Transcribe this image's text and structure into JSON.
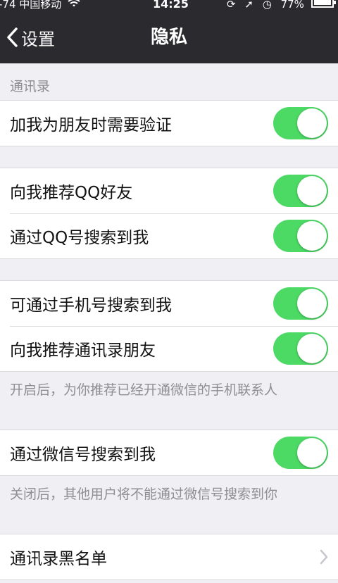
{
  "status_bar": {
    "carrier": "-74 中国移动",
    "time": "14:25",
    "battery": "77%",
    "icons": [
      "rotation-lock-icon",
      "location-icon",
      "alarm-icon"
    ]
  },
  "nav": {
    "back_label": "设置",
    "title": "隐私"
  },
  "sections": {
    "contacts_header": "通讯录"
  },
  "settings": {
    "verify_friend": {
      "label": "加我为朋友时需要验证",
      "enabled": true
    },
    "recommend_qq": {
      "label": "向我推荐QQ好友",
      "enabled": true
    },
    "search_by_qq": {
      "label": "通过QQ号搜索到我",
      "enabled": true
    },
    "search_by_phone": {
      "label": "可通过手机号搜索到我",
      "enabled": true
    },
    "recommend_contacts": {
      "label": "向我推荐通讯录朋友",
      "enabled": true
    },
    "contacts_note": "开启后，为你推荐已经开通微信的手机联系人",
    "search_by_wechat": {
      "label": "通过微信号搜索到我",
      "enabled": true
    },
    "wechat_note": "关闭后，其他用户将不能通过微信号搜索到你",
    "blacklist": {
      "label": "通讯录黑名单"
    }
  },
  "colors": {
    "toggle_on": "#4cd964",
    "nav_bg": "#2b2b2f",
    "page_bg": "#efeff4"
  }
}
